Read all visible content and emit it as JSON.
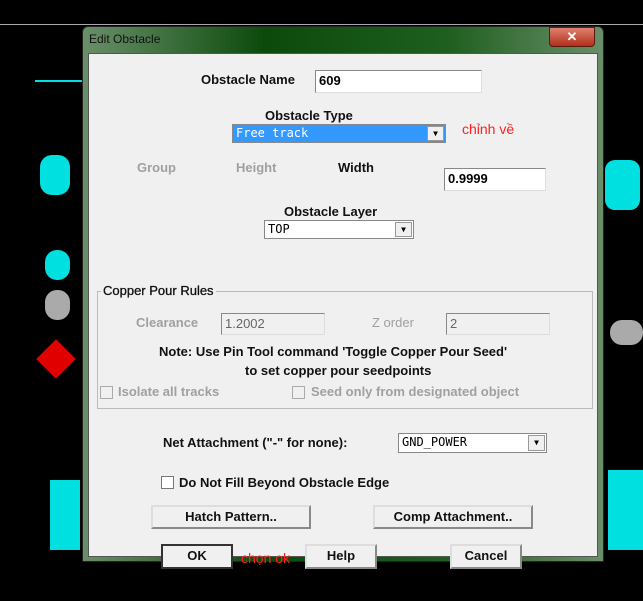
{
  "window": {
    "title": "Edit Obstacle",
    "close_label": "✕"
  },
  "obstacle_name": {
    "label": "Obstacle Name",
    "value": "609"
  },
  "obstacle_type": {
    "label": "Obstacle Type",
    "value": "Free track"
  },
  "annotation_type": "chỉnh về",
  "group_label": "Group",
  "height_label": "Height",
  "width": {
    "label": "Width",
    "value": "0.9999"
  },
  "obstacle_layer": {
    "label": "Obstacle Layer",
    "value": "TOP"
  },
  "copper_pour": {
    "title": "Copper Pour Rules",
    "clearance_label": "Clearance",
    "clearance_value": "1.2002",
    "zorder_label": "Z order",
    "zorder_value": "2",
    "note1": "Note: Use Pin Tool command 'Toggle Copper Pour Seed'",
    "note2": "to set copper pour seedpoints",
    "isolate_label": "Isolate all tracks",
    "seed_label": "Seed only from designated object"
  },
  "net_attachment": {
    "label": "Net Attachment (\"-\" for none):",
    "value": "GND_POWER"
  },
  "no_fill_label": "Do Not Fill Beyond Obstacle Edge",
  "buttons": {
    "hatch": "Hatch Pattern..",
    "comp": "Comp Attachment..",
    "ok": "OK",
    "help": "Help",
    "cancel": "Cancel"
  },
  "annotation_ok": "chọn ok"
}
